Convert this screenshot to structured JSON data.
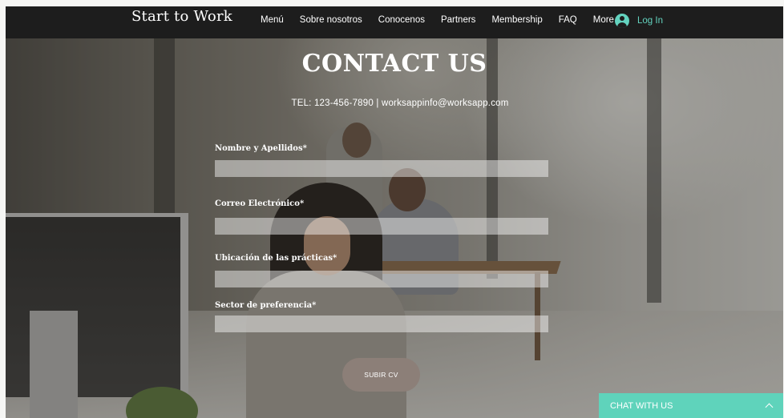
{
  "nav": {
    "brand": "Start to Work",
    "items": [
      "Menú",
      "Sobre nosotros",
      "Conocenos",
      "Partners",
      "Membership",
      "FAQ",
      "More"
    ],
    "login_label": "Log In"
  },
  "hero": {
    "title": "CONTACT US",
    "contact_line": "TEL: 123-456-7890  |  worksappinfo@worksapp.com"
  },
  "form": {
    "fields": [
      {
        "label": "Nombre y Apellidos*",
        "value": ""
      },
      {
        "label": "Correo Electrónico*",
        "value": ""
      },
      {
        "label": "Ubicación de las prácticas*",
        "value": ""
      },
      {
        "label": "Sector de preferencia*",
        "value": ""
      }
    ],
    "submit_label": "SUBIR CV"
  },
  "chat": {
    "label": "CHAT WITH US"
  },
  "colors": {
    "nav_bg": "#1d1d1d",
    "accent": "#63d3bf",
    "chat_bg": "#5fd3bb",
    "button_bg": "#8c7f78"
  },
  "icons": {
    "login": "user-avatar-icon",
    "chat_toggle": "chevron-up-icon"
  }
}
